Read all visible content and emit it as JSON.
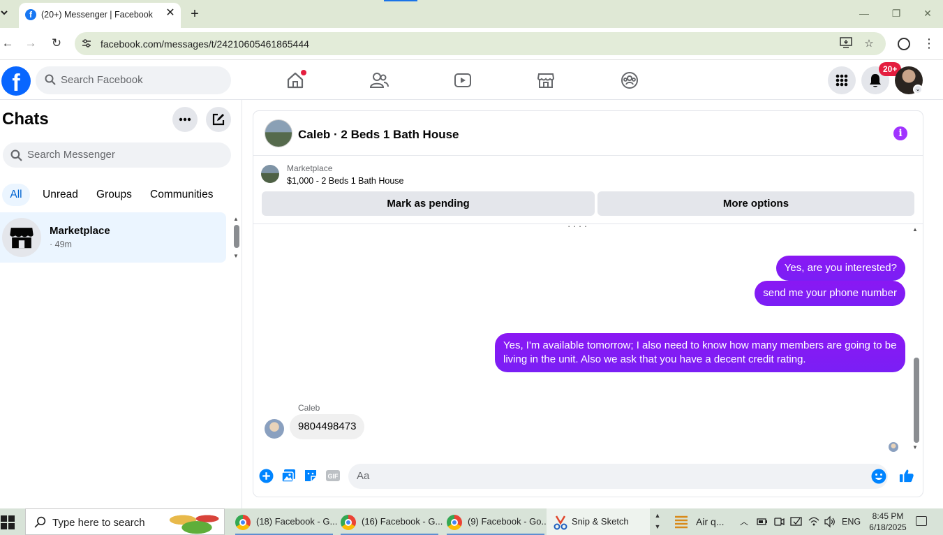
{
  "browser": {
    "tab_title": "(20+) Messenger | Facebook",
    "url": "facebook.com/messages/t/24210605461865444"
  },
  "facebook": {
    "search_placeholder": "Search Facebook",
    "notification_count": "20+"
  },
  "chats": {
    "title": "Chats",
    "search_placeholder": "Search Messenger",
    "filters": [
      "All",
      "Unread",
      "Groups",
      "Communities"
    ],
    "active_filter": "All",
    "items": [
      {
        "name": "Marketplace",
        "subtitle": "· 49m"
      }
    ]
  },
  "conversation": {
    "title": "Caleb · 2 Beds 1 Bath House",
    "marketplace": {
      "label": "Marketplace",
      "listing": "$1,000 - 2 Beds 1 Bath House",
      "pending_button": "Mark as pending",
      "options_button": "More options"
    },
    "messages": [
      {
        "direction": "out",
        "text": "Yes, are you interested?"
      },
      {
        "direction": "out",
        "text": "send me your phone number"
      },
      {
        "direction": "out",
        "text": "Yes, I'm available tomorrow; I also need to know how many members are going to be living in the unit. Also we ask that you have a decent credit rating."
      },
      {
        "direction": "in",
        "sender": "Caleb",
        "text": "9804498473"
      }
    ],
    "composer_placeholder": "Aa",
    "accent_color": "#8b00ff"
  },
  "taskbar": {
    "search_placeholder": "Type here to search",
    "apps": [
      {
        "label": "(18) Facebook - G..."
      },
      {
        "label": "(16) Facebook - G..."
      },
      {
        "label": "(9) Facebook - Go..."
      },
      {
        "label": "Snip & Sketch"
      },
      {
        "label": "Air q..."
      }
    ],
    "language": "ENG",
    "time": "8:45 PM",
    "date": "6/18/2025"
  }
}
